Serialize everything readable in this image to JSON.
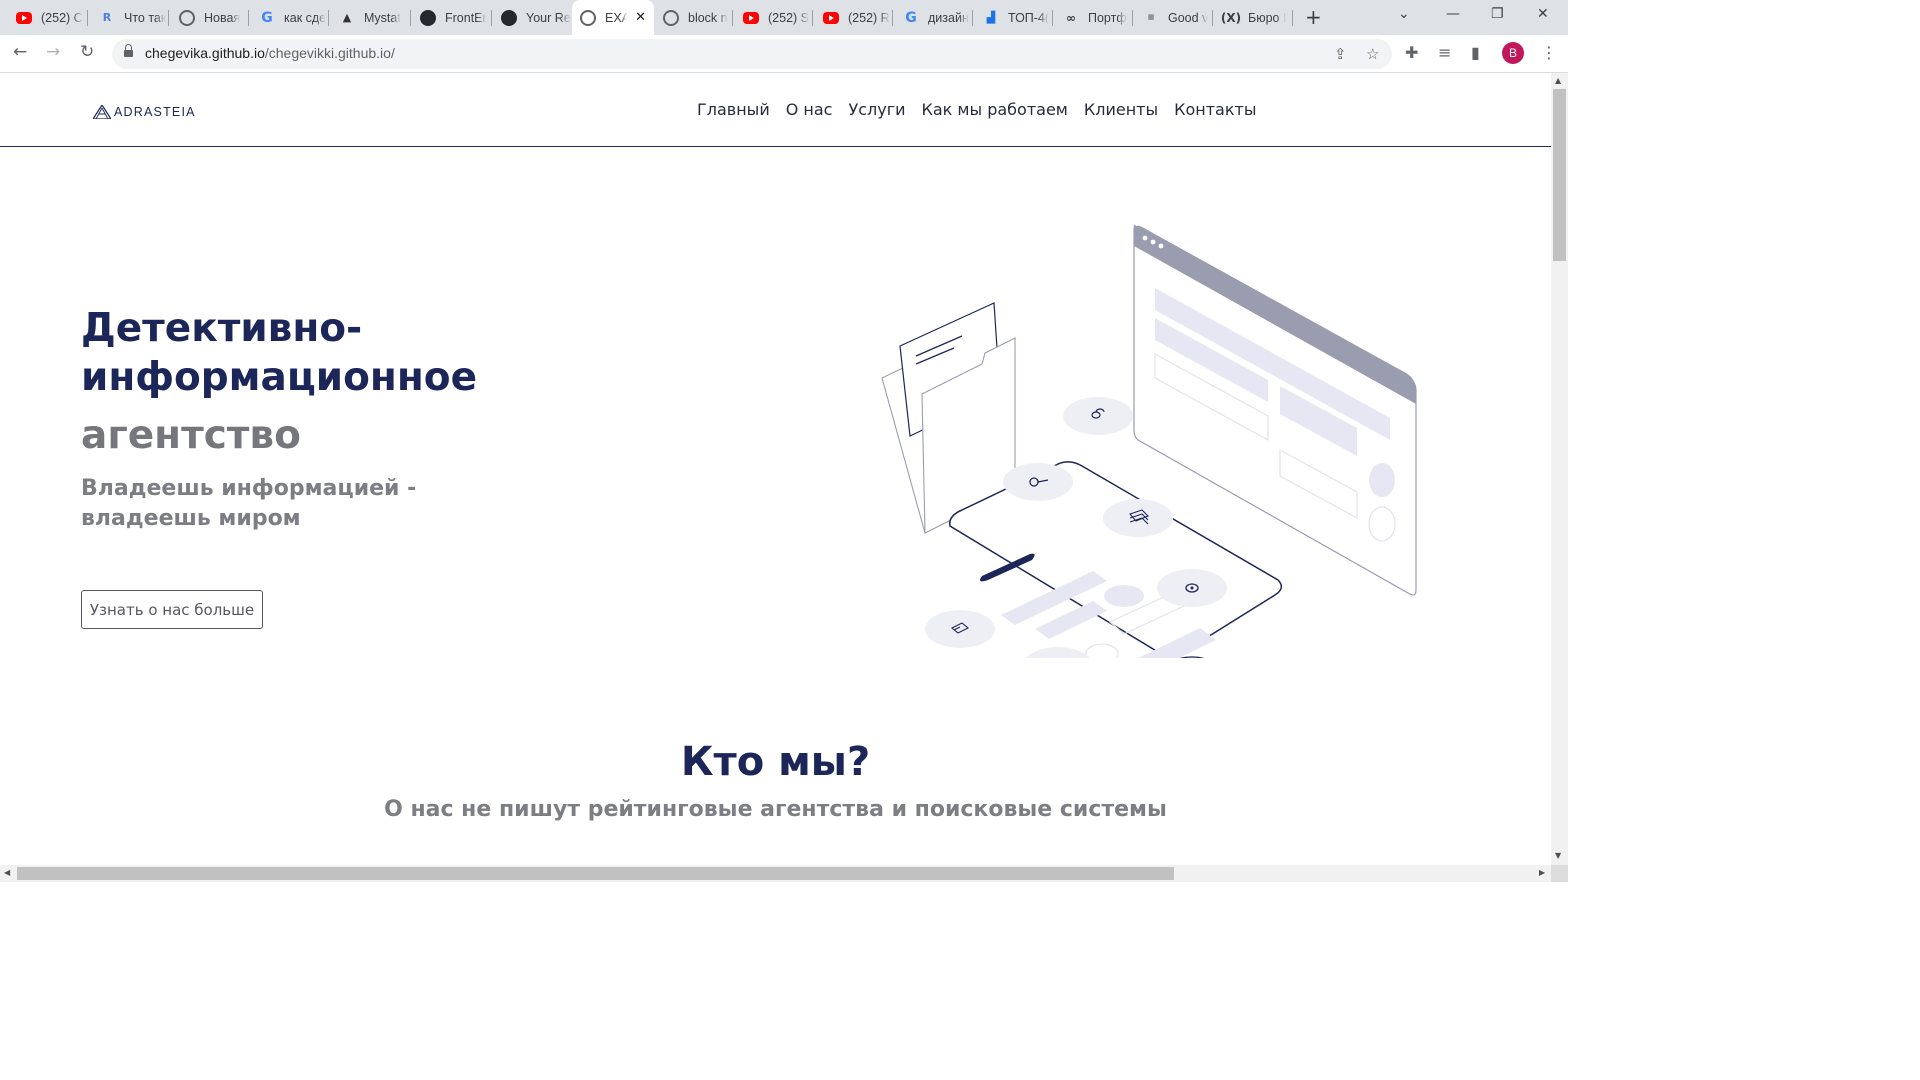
{
  "browser": {
    "tabs": [
      {
        "icon": "youtube-icon",
        "label": "(252) C"
      },
      {
        "icon": "r-logo-icon",
        "label": "Что так"
      },
      {
        "icon": "chrome-icon",
        "label": "Новая"
      },
      {
        "icon": "google-icon",
        "label": "как сде"
      },
      {
        "icon": "mystat-icon",
        "label": "Mystat"
      },
      {
        "icon": "github-icon",
        "label": "FrontEr"
      },
      {
        "icon": "github-icon",
        "label": "Your Re"
      },
      {
        "icon": "globe-icon",
        "label": "EXA"
      },
      {
        "icon": "globe-icon",
        "label": "block n"
      },
      {
        "icon": "youtube-icon",
        "label": "(252) S"
      },
      {
        "icon": "youtube-icon",
        "label": "(252) R"
      },
      {
        "icon": "google-icon",
        "label": "дизайн"
      },
      {
        "icon": "chart-icon",
        "label": "ТОП-4("
      },
      {
        "icon": "portfolio-icon",
        "label": "Портф"
      },
      {
        "icon": "goodweb-icon",
        "label": "Good v"
      },
      {
        "icon": "co-icon",
        "label": "Бюро I"
      }
    ],
    "active_tab_index": 7,
    "url_host": "chegevika.github.io",
    "url_path": "/chegevikki.github.io/",
    "profile_initial": "B"
  },
  "site": {
    "logo_text": "ADRASTEIA",
    "menu": [
      "Главный",
      "О нас",
      "Услуги",
      "Как мы работаем",
      "Клиенты",
      "Контакты"
    ],
    "hero": {
      "title_line1": "Детективно-",
      "title_line2": "информационное",
      "title_line3": "агентство",
      "subtitle": "Владеешь информацией - владеешь миром",
      "button": "Узнать о нас больше"
    },
    "about": {
      "title": "Кто мы?",
      "subtitle": "О нас не пишут рейтинговые агентства и поисковые системы"
    }
  },
  "colors": {
    "brand_navy": "#1c2659",
    "muted_gray": "#7c7e84"
  }
}
